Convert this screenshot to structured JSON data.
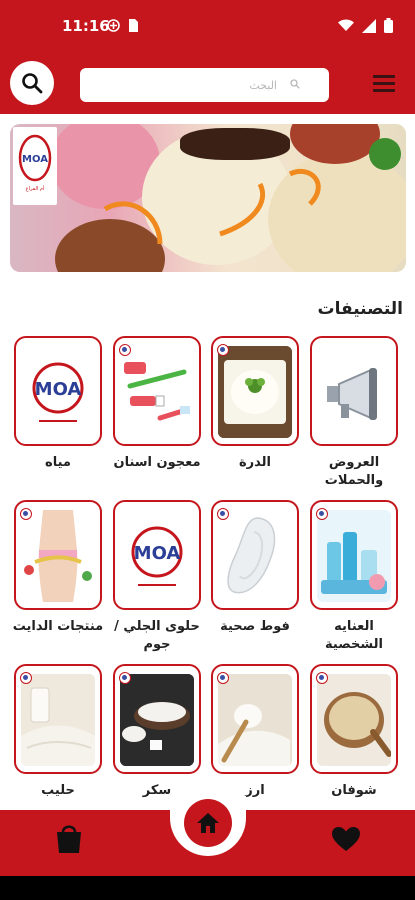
{
  "status_bar": {
    "time": "11:16"
  },
  "search": {
    "placeholder": "البحث"
  },
  "banner": {
    "logo_text": "MOA",
    "logo_tagline": "أم الفراغ"
  },
  "categories_section": {
    "title": "التصنيفات",
    "items": [
      {
        "label": "العروض والحملات",
        "icon": "megaphone-icon"
      },
      {
        "label": "الدرة",
        "icon": "food-dish-icon"
      },
      {
        "label": "معجون اسنان",
        "icon": "toothbrush-icon"
      },
      {
        "label": "مياه",
        "icon": "moa-logo-icon"
      },
      {
        "label": "العنايه الشخصية",
        "icon": "personal-care-icon"
      },
      {
        "label": "فوط صحية",
        "icon": "sanitary-pad-icon"
      },
      {
        "label": "حلوى الجلي / جوم",
        "icon": "moa-logo-icon"
      },
      {
        "label": "منتجات الدايت",
        "icon": "diet-icon"
      },
      {
        "label": "شوفان",
        "icon": "oats-icon"
      },
      {
        "label": "ارز",
        "icon": "rice-icon"
      },
      {
        "label": "سكر",
        "icon": "sugar-icon"
      },
      {
        "label": "حليب",
        "icon": "milk-icon"
      }
    ]
  },
  "colors": {
    "primary": "#c4161c",
    "text": "#222222"
  },
  "bottom_nav": {
    "left": "cart-icon",
    "center": "home-icon",
    "right": "heart-icon"
  }
}
